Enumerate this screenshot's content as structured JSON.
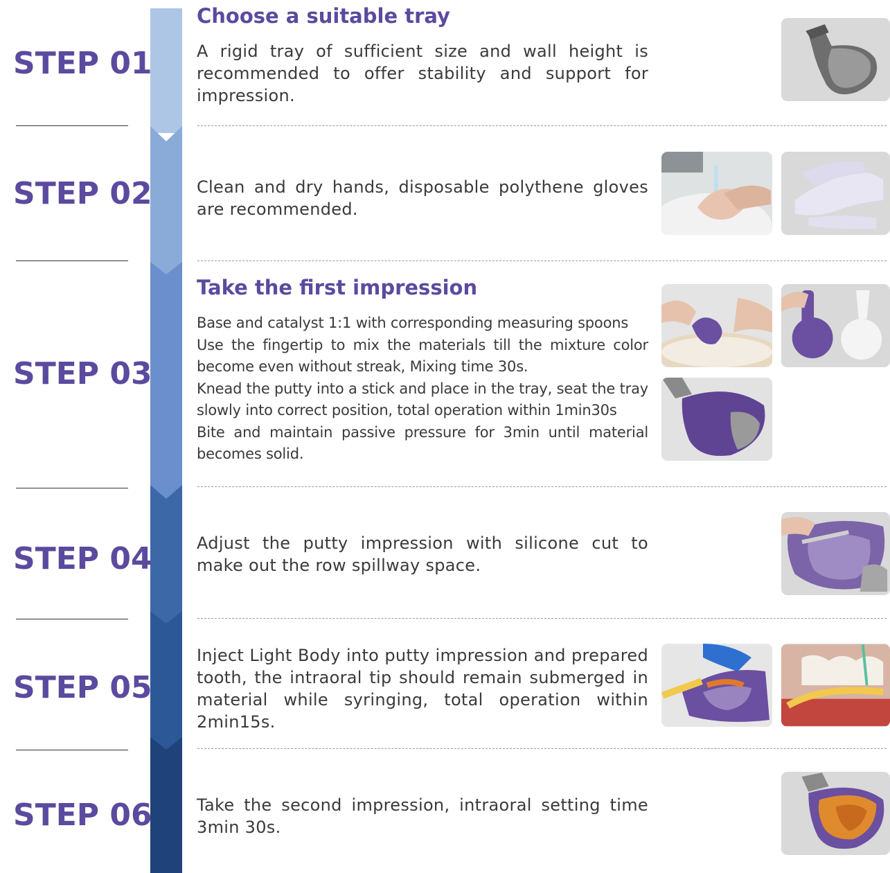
{
  "colors": {
    "accent": "#5b4a9e",
    "band": [
      "#aec6e6",
      "#8aaad8",
      "#6b8fcc",
      "#3d68a8",
      "#2d5897",
      "#1e4279"
    ]
  },
  "steps": [
    {
      "label": "STEP 01",
      "title": "Choose a suitable tray",
      "text": "A rigid tray of sufficient size and wall height is recommended to offer stability and support for impression.",
      "images": [
        "metal-impression-tray-icon"
      ]
    },
    {
      "label": "STEP 02",
      "title": "",
      "text": "Clean and dry hands, disposable polythene gloves are recommended.",
      "images": [
        "hand-washing-icon",
        "gloves-icon"
      ]
    },
    {
      "label": "STEP 03",
      "title": "Take the first impression",
      "lines": [
        "Base and catalyst 1:1 with corresponding measuring spoons",
        "Use the fingertip to mix the materials till the mixture color become even without streak, Mixing time 30s.",
        "Knead the putty into a stick and place in the tray, seat the tray slowly into correct position, total operation within 1min30s",
        "Bite and maintain passive pressure for 3min until material becomes solid."
      ],
      "images": [
        "mixing-putty-icon",
        "measuring-spoon-icon",
        "putty-in-tray-icon"
      ]
    },
    {
      "label": "STEP 04",
      "title": "",
      "text": "Adjust the putty impression with silicone cut to make out the row spillway space.",
      "images": [
        "trimming-impression-icon"
      ]
    },
    {
      "label": "STEP 05",
      "title": "",
      "text": "Inject Light Body into putty impression and prepared tooth, the intraoral tip should remain submerged in material while syringing, total operation within 2min15s.",
      "images": [
        "syringe-into-impression-icon",
        "syringe-on-tooth-icon"
      ]
    },
    {
      "label": "STEP 06",
      "title": "",
      "text": "Take the second impression, intraoral setting time 3min 30s.",
      "images": [
        "final-impression-icon"
      ]
    }
  ]
}
